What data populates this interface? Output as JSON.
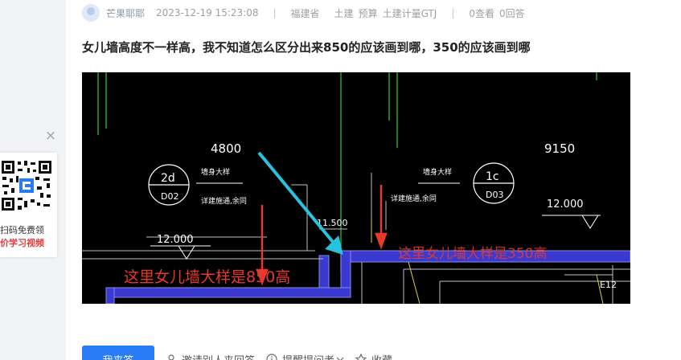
{
  "ad": {
    "close_glyph": "×",
    "line1": "扫码免费领",
    "line2": "价学习视频"
  },
  "post": {
    "user": "芒果耶耶",
    "time": "2023-12-19 15:23:08",
    "separator": "|",
    "region": "福建省",
    "tags": [
      "土建",
      "预算",
      "土建计量GTJ"
    ],
    "views": "0查看",
    "answers": "0回答",
    "title": "女儿墙高度不一样高，我不知道怎么区分出来850的应该画到哪，350的应该画到哪"
  },
  "drawing": {
    "dim_left": "4800",
    "dim_right": "9150",
    "axis_left_top": "2d",
    "axis_left_bottom": "D02",
    "axis_right_top": "1c",
    "axis_right_bottom": "D03",
    "detail_title": "墙身大样",
    "detail_note": "详建施通,余同",
    "elev_left": "12.000",
    "elev_right": "12.000",
    "elev_mid": "11.500",
    "note_850": "这里女儿墙大样是850高",
    "note_350": "这里女儿墙大样是350高",
    "axis_code": "E12"
  },
  "actions": {
    "answer_label": "我来答",
    "invite_label": "邀请别人来回答",
    "remind_label": "提醒提问者"
  },
  "more_label": "收藏",
  "colors": {
    "accent": "#2a7cf6",
    "wall": "#3a3ad0",
    "annotation": "#e8392a",
    "arrow": "#27c4e0"
  }
}
